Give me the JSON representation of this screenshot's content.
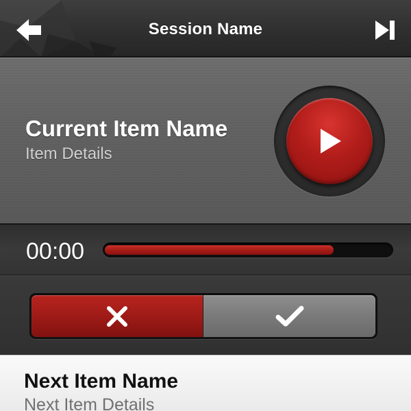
{
  "header": {
    "title": "Session Name",
    "back_icon": "arrow-left-icon",
    "skip_icon": "skip-forward-icon"
  },
  "now_playing": {
    "item_name": "Current Item Name",
    "item_details": "Item Details",
    "play_icon": "play-icon"
  },
  "progress": {
    "elapsed": "00:00",
    "fraction": 0.8
  },
  "segmented_control": {
    "reject_icon": "close-icon",
    "accept_icon": "checkmark-icon"
  },
  "next_item": {
    "name": "Next Item Name",
    "details": "Next Item Details"
  },
  "colors": {
    "accent_red": "#b11d1a",
    "header_bg": "#2f2f2f",
    "panel_bg": "#626262",
    "next_item_bg": "#f2f2f2"
  }
}
